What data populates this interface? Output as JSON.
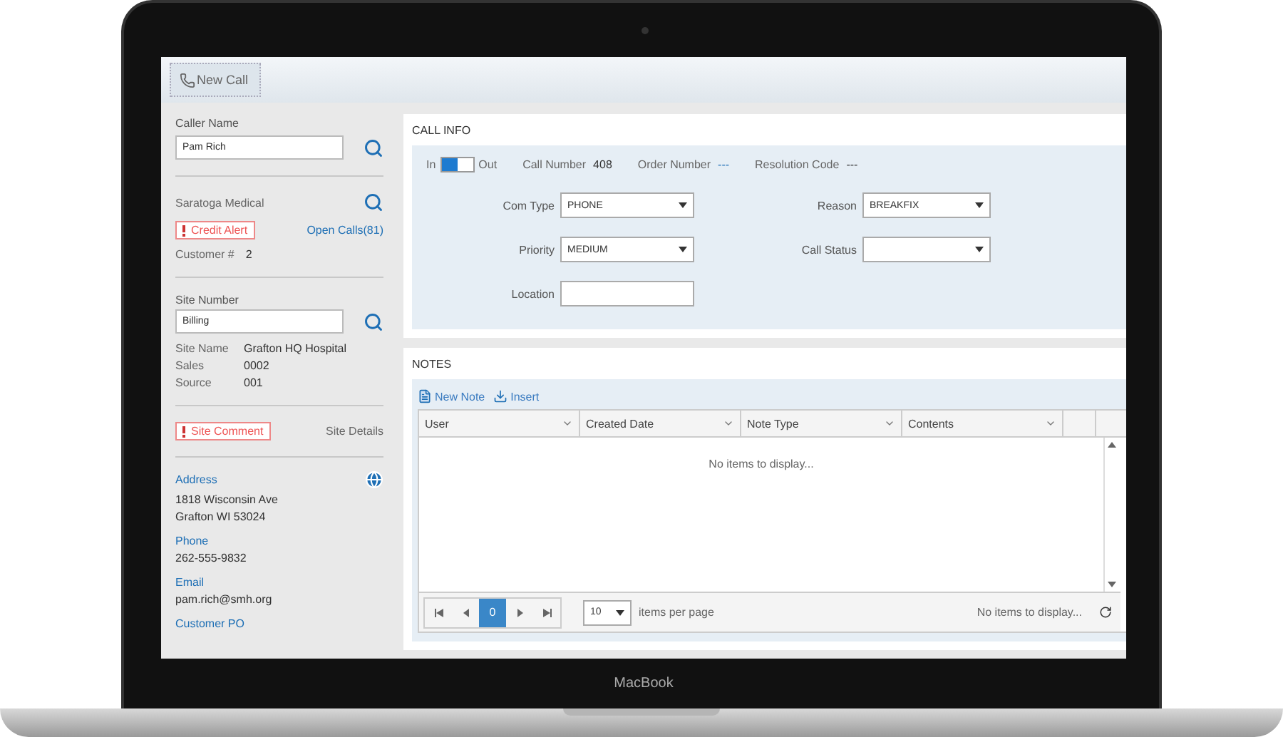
{
  "toolbar": {
    "new_call": "New Call"
  },
  "caller": {
    "label": "Caller Name",
    "value": "Pam Rich"
  },
  "customer": {
    "name": "Saratoga Medical",
    "alert": "Credit Alert",
    "open_calls": "Open Calls(81)",
    "number_label": "Customer #",
    "number": "2"
  },
  "site": {
    "label": "Site Number",
    "value": "Billing",
    "comment": "Site Comment",
    "details_link": "Site Details",
    "details": [
      {
        "label": "Site Name",
        "value": "Grafton HQ Hospital"
      },
      {
        "label": "Sales",
        "value": "0002"
      },
      {
        "label": "Source",
        "value": "001"
      }
    ]
  },
  "contact": [
    {
      "label": "Address",
      "lines": [
        "1818 Wisconsin Ave",
        "Grafton  WI  53024"
      ]
    },
    {
      "label": "Phone",
      "lines": [
        "262-555-9832"
      ]
    },
    {
      "label": "Email",
      "lines": [
        "pam.rich@smh.org"
      ]
    },
    {
      "label": "Customer PO"
    }
  ],
  "call_info": {
    "title": "CALL INFO",
    "toggle": {
      "left": "In",
      "right": "Out",
      "in_selected": true
    },
    "stats": [
      {
        "label": "Call Number",
        "value": "408",
        "kind": "plain"
      },
      {
        "label": "Order Number",
        "value": "---",
        "kind": "link"
      },
      {
        "label": "Resolution Code",
        "value": "---",
        "kind": "plain"
      }
    ],
    "fields": [
      {
        "label": "Com Type",
        "value": "PHONE",
        "kind": "select"
      },
      {
        "label": "Reason",
        "value": "BREAKFIX",
        "kind": "select"
      },
      {
        "label": "Priority",
        "value": "MEDIUM",
        "kind": "select"
      },
      {
        "label": "Call Status",
        "kind": "select"
      },
      {
        "label": "Location",
        "kind": "text"
      }
    ]
  },
  "notes": {
    "title": "NOTES",
    "actions": [
      {
        "label": "New Note",
        "kind": "new"
      },
      {
        "label": "Insert",
        "kind": "insert"
      }
    ],
    "columns": [
      "User",
      "Created Date",
      "Note Type",
      "Contents"
    ],
    "empty": "No items to display...",
    "pager": {
      "pages": [
        {
          "label": "0",
          "selected": true
        }
      ],
      "page_size": "10",
      "per_page_label": "items per page",
      "status": "No items to display..."
    }
  },
  "device": {
    "label": "MacBook"
  }
}
